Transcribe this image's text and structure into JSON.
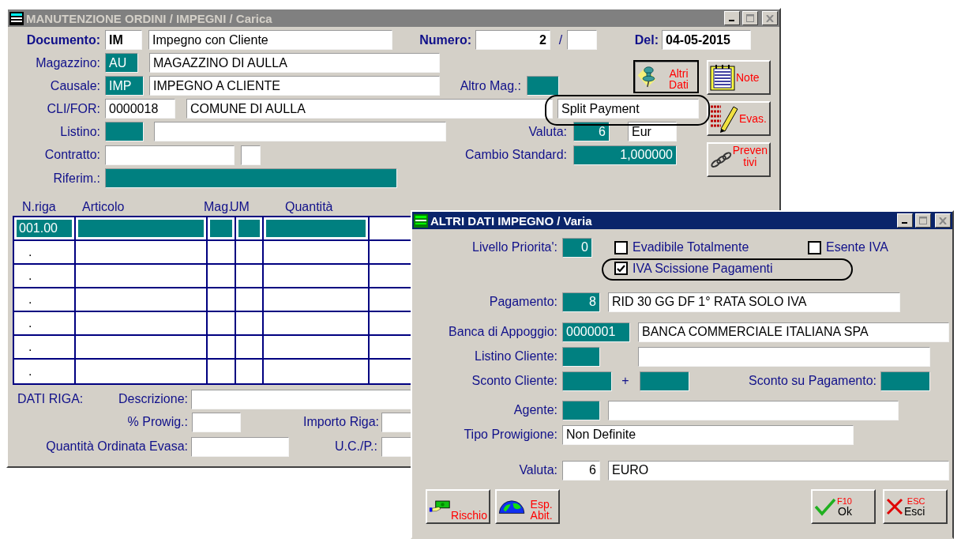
{
  "main_window": {
    "title": "MANUTENZIONE ORDINI / IMPEGNI / Carica",
    "active": false,
    "documento": {
      "label": "Documento:",
      "code": "IM",
      "description": "Impegno con Cliente"
    },
    "numero": {
      "label": "Numero:",
      "value": "2",
      "separator": "/"
    },
    "del": {
      "label": "Del:",
      "value": "04-05-2015"
    },
    "magazzino": {
      "label": "Magazzino:",
      "code": "AU",
      "description": "MAGAZZINO DI AULLA"
    },
    "causale": {
      "label": "Causale:",
      "code": "IMP",
      "description": "IMPEGNO A CLIENTE"
    },
    "altro_mag": {
      "label": "Altro Mag.:"
    },
    "cli_for": {
      "label": "CLI/FOR:",
      "code": "0000018",
      "description": "COMUNE DI AULLA",
      "note": "Split Payment",
      "highlighted": true
    },
    "listino": {
      "label": "Listino:"
    },
    "valuta": {
      "label": "Valuta:",
      "code": "6",
      "description": "Eur"
    },
    "contratto": {
      "label": "Contratto:"
    },
    "cambio": {
      "label": "Cambio Standard:",
      "value": "1,000000"
    },
    "riferim": {
      "label": "Riferim.:"
    },
    "buttons": [
      {
        "label": "Altri Dati",
        "kind": "pin",
        "pressed": true
      },
      {
        "label": "Note",
        "kind": "notes",
        "pressed": false
      },
      {
        "label": "Evas.",
        "kind": "pencil",
        "pressed": false
      },
      {
        "label": "Preven\ntivi",
        "kind": "chain",
        "pressed": false
      }
    ],
    "table": {
      "columns": [
        "N.riga",
        "Articolo",
        "Mag.",
        "UM",
        "Quantità"
      ],
      "rows": [
        {
          "n_riga": "001.00",
          "selected": true
        },
        {
          "n_riga": ".",
          "selected": false
        },
        {
          "n_riga": ".",
          "selected": false
        },
        {
          "n_riga": ".",
          "selected": false
        },
        {
          "n_riga": ".",
          "selected": false
        },
        {
          "n_riga": ".",
          "selected": false
        },
        {
          "n_riga": ".",
          "selected": false
        }
      ]
    },
    "dati_riga": {
      "label": "DATI RIGA:",
      "descrizione": "Descrizione:",
      "provvig": "% Prowig.:",
      "importo": "Importo Riga:",
      "quantita_evasa": "Quantità Ordinata Evasa:",
      "ucp": "U.C./P.:"
    }
  },
  "dialog": {
    "title": "ALTRI DATI IMPEGNO / Varia",
    "active": true,
    "livello": {
      "label": "Livello Priorita':",
      "value": "0"
    },
    "checkboxes": [
      {
        "label": "Evadibile Totalmente",
        "checked": false
      },
      {
        "label": "Esente IVA",
        "checked": false
      },
      {
        "label": "IVA Scissione Pagamenti",
        "checked": true,
        "highlighted": true
      }
    ],
    "pagamento": {
      "label": "Pagamento:",
      "code": "8",
      "description": "RID 30 GG DF 1° RATA SOLO IVA"
    },
    "banca": {
      "label": "Banca di Appoggio:",
      "code": "0000001",
      "description": "BANCA COMMERCIALE ITALIANA SPA"
    },
    "listino_cliente": {
      "label": "Listino Cliente:"
    },
    "sconto_cliente": {
      "label": "Sconto Cliente:",
      "plus": "+"
    },
    "sconto_pagamento": {
      "label": "Sconto su Pagamento:"
    },
    "agente": {
      "label": "Agente:"
    },
    "tipo_provvigione": {
      "label": "Tipo Prowigione:",
      "value": "Non Definite"
    },
    "valuta": {
      "label": "Valuta:",
      "code": "6",
      "description": "EURO"
    },
    "buttons": [
      {
        "label": "Rischio",
        "kind": "money"
      },
      {
        "label": "Esp. Abit.",
        "kind": "globe"
      },
      {
        "label": "Ok",
        "key": "F10",
        "kind": "ok"
      },
      {
        "label": "Esci",
        "key": "ESC",
        "kind": "cancel"
      }
    ]
  }
}
